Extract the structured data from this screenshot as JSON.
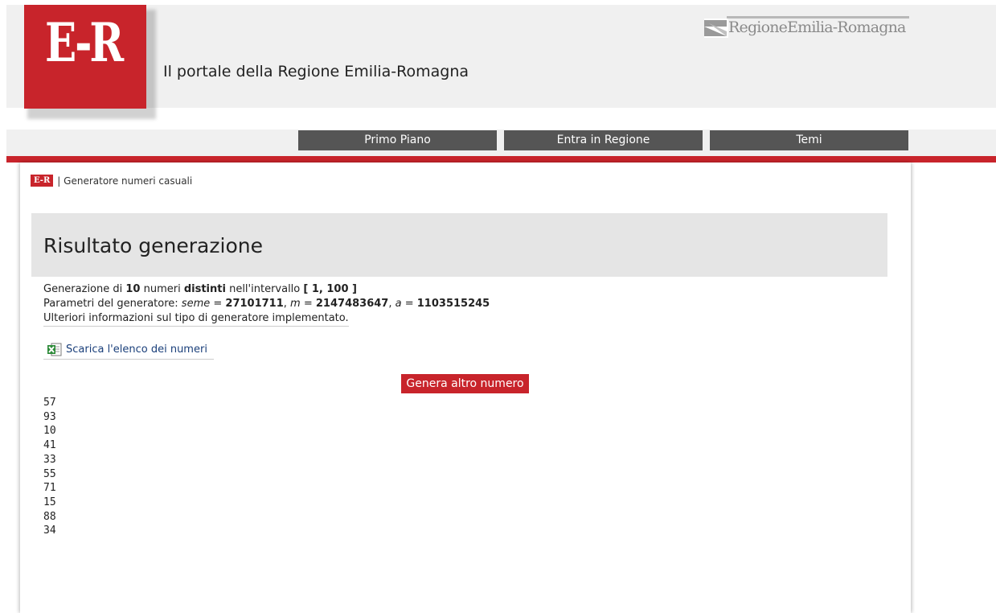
{
  "header": {
    "logo_text": "E-R",
    "tagline": "Il portale della Regione Emilia-Romagna",
    "brand_text": "RegioneEmilia-Romagna"
  },
  "nav": {
    "items": [
      {
        "label": "Primo Piano"
      },
      {
        "label": "Entra in Regione"
      },
      {
        "label": "Temi"
      }
    ]
  },
  "breadcrumb": {
    "logo": "E-R",
    "separator": "|",
    "current": "Generatore numeri casuali"
  },
  "main": {
    "title": "Risultato generazione",
    "line1": {
      "prefix": "Generazione di ",
      "count": "10",
      "mid1": " numeri ",
      "distinct": "distinti",
      "mid2": " nell'intervallo ",
      "range": "[ 1, 100 ]"
    },
    "line2": {
      "prefix": "Parametri del generatore: ",
      "seed_label": "seme",
      "eq": " = ",
      "seed_value": "27101711",
      "sep": ", ",
      "m_label": "m",
      "m_value": "2147483647",
      "a_label": "a",
      "a_value": "1103515245"
    },
    "info_link": "Ulteriori informazioni sul tipo di generatore implementato.",
    "download_label": "Scarica l'elenco dei numeri",
    "generate_button": "Genera altro numero",
    "numbers": [
      "57",
      "93",
      "10",
      "41",
      "33",
      "55",
      "71",
      "15",
      "88",
      "34"
    ]
  },
  "colors": {
    "brand_red": "#c8242b",
    "nav_bg": "#555555",
    "header_bg": "#f0f0f0",
    "title_box_bg": "#e5e5e5",
    "link_blue": "#1a3f7a"
  },
  "icons": {
    "download": "excel-file-icon",
    "brand": "region-flag-icon"
  }
}
